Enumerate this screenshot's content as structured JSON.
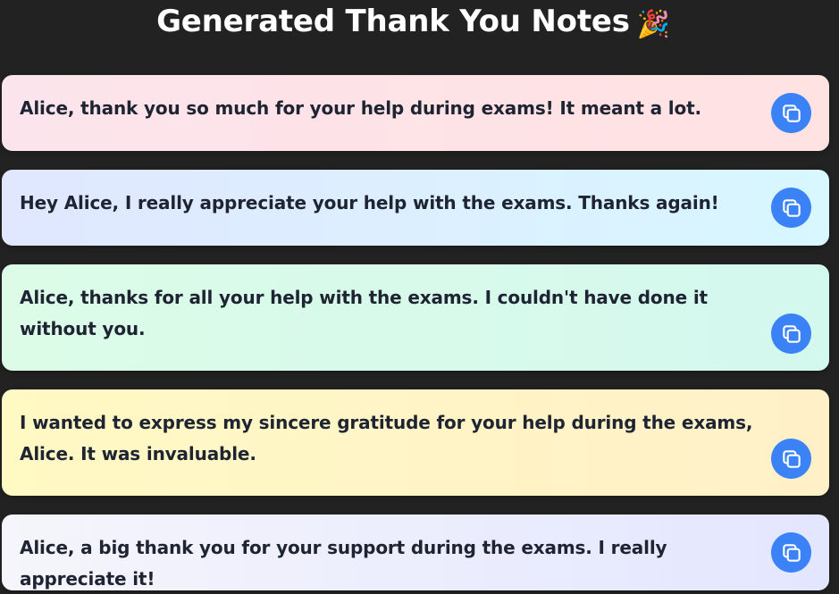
{
  "header": {
    "title": "Generated Thank You Notes",
    "emoji": "🎉"
  },
  "notes": [
    {
      "text": "Alice, thank you so much for your help during exams! It meant a lot.",
      "gradient": [
        "#fce4ec",
        "#ffe2e2"
      ]
    },
    {
      "text": "Hey Alice, I really appreciate your help with the exams. Thanks again!",
      "gradient": [
        "#e0e7ff",
        "#d8f7ff"
      ]
    },
    {
      "text": "Alice, thanks for all your help with the exams. I couldn't have done it without you.",
      "gradient": [
        "#dcfce7",
        "#d3f8ee"
      ]
    },
    {
      "text": "I wanted to express my sincere gratitude for your help during the exams, Alice. It was invaluable.",
      "gradient": [
        "#fff9c4",
        "#fff0c8"
      ]
    },
    {
      "text": "Alice, a big thank you for your support during the exams. I really appreciate it!",
      "gradient": [
        "#f5f5fb",
        "#e3e6ff"
      ]
    }
  ],
  "colors": {
    "background": "#222222",
    "button": "#3b82f6",
    "text": "#1f2433"
  },
  "icons": {
    "copy": "copy-icon"
  }
}
